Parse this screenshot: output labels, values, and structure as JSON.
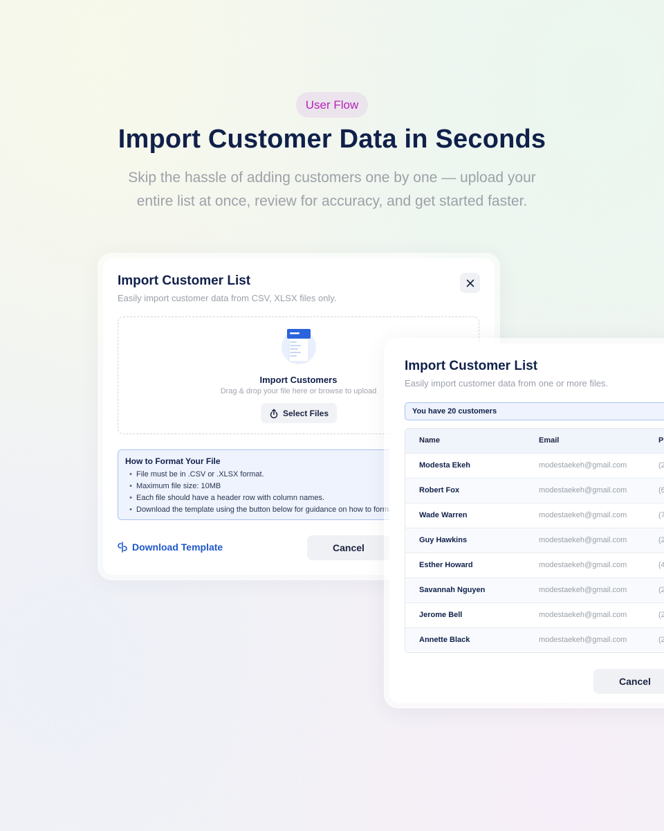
{
  "hero": {
    "pill": "User Flow",
    "title": "Import Customer Data in Seconds",
    "subtitle": "Skip the hassle of adding customers one by one — upload your entire list at once, review for accuracy, and get started faster."
  },
  "upload_modal": {
    "title": "Import Customer List",
    "subtitle": "Easily import customer data from CSV, XLSX files only.",
    "close_icon": "close-icon",
    "dropzone": {
      "title": "Import Customers",
      "hint": "Drag & drop your file here or browse to upload",
      "button_label": "Select Files"
    },
    "format_help": {
      "title": "How to Format Your File",
      "items": [
        "File must be in .CSV or .XLSX format.",
        "Maximum file size: 10MB",
        "Each file should have a header row with column names.",
        "Download the template using the button below for guidance on how to format"
      ]
    },
    "download_label": "Download Template",
    "cancel_label": "Cancel"
  },
  "review_modal": {
    "title": "Import Customer List",
    "subtitle": "Easily import customer data from one or more files.",
    "count_banner": "You have 20 customers",
    "columns": [
      "Name",
      "Email",
      "Ph"
    ],
    "rows": [
      {
        "name": "Modesta Ekeh",
        "email": "modestaekeh@gmail.com",
        "phone": "(2"
      },
      {
        "name": "Robert Fox",
        "email": "modestaekeh@gmail.com",
        "phone": "(6"
      },
      {
        "name": "Wade Warren",
        "email": "modestaekeh@gmail.com",
        "phone": "(7"
      },
      {
        "name": "Guy Hawkins",
        "email": "modestaekeh@gmail.com",
        "phone": "(2"
      },
      {
        "name": "Esther Howard",
        "email": "modestaekeh@gmail.com",
        "phone": "(4"
      },
      {
        "name": "Savannah Nguyen",
        "email": "modestaekeh@gmail.com",
        "phone": "(2"
      },
      {
        "name": "Jerome Bell",
        "email": "modestaekeh@gmail.com",
        "phone": "(2"
      },
      {
        "name": "Annette Black",
        "email": "modestaekeh@gmail.com",
        "phone": "(2"
      }
    ],
    "cancel_label": "Cancel"
  },
  "colors": {
    "navy": "#10204a",
    "accent_blue": "#2058c9",
    "pill_magenta": "#b424b8",
    "info_bg": "#eef3fd",
    "info_border": "#a9c1f0"
  }
}
